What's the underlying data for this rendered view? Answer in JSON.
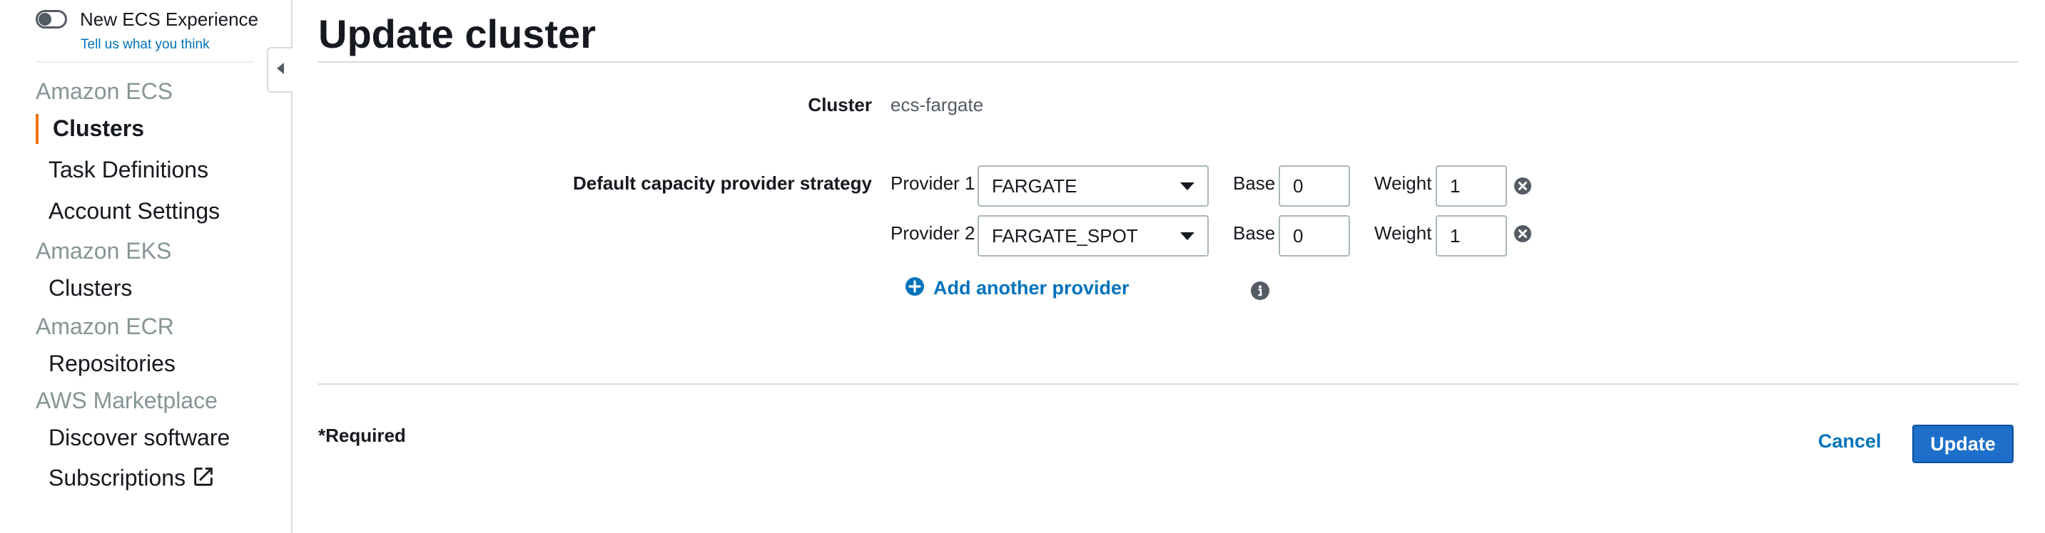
{
  "sidebar": {
    "new_experience_label": "New ECS Experience",
    "feedback_link": "Tell us what you think",
    "sections": {
      "ecs": {
        "heading": "Amazon ECS",
        "items": [
          "Clusters",
          "Task Definitions",
          "Account Settings"
        ]
      },
      "eks": {
        "heading": "Amazon EKS",
        "items": [
          "Clusters"
        ]
      },
      "ecr": {
        "heading": "Amazon ECR",
        "items": [
          "Repositories"
        ]
      },
      "marketplace": {
        "heading": "AWS Marketplace",
        "items": [
          "Discover software",
          "Subscriptions"
        ]
      }
    },
    "active_item": "Clusters",
    "toggle_on": false
  },
  "page": {
    "title": "Update cluster",
    "cluster_label": "Cluster",
    "cluster_value": "ecs-fargate",
    "strategy_label": "Default capacity provider strategy",
    "providers": [
      {
        "label": "Provider 1",
        "value": "FARGATE",
        "base_label": "Base",
        "base": "0",
        "weight_label": "Weight",
        "weight": "1"
      },
      {
        "label": "Provider 2",
        "value": "FARGATE_SPOT",
        "base_label": "Base",
        "base": "0",
        "weight_label": "Weight",
        "weight": "1"
      }
    ],
    "add_provider_label": "Add another provider",
    "required_note": "*Required",
    "cancel_label": "Cancel",
    "update_label": "Update"
  },
  "colors": {
    "accent": "#ec7211",
    "link": "#0073bb",
    "primary_button": "#1d6fc9",
    "muted_heading": "#879596"
  },
  "icons": {
    "toggle": "toggle-switch-icon",
    "collapse": "caret-left-icon",
    "external": "external-link-icon",
    "remove": "remove-circle-icon",
    "add": "add-plus-circle-icon",
    "info": "info-icon"
  }
}
